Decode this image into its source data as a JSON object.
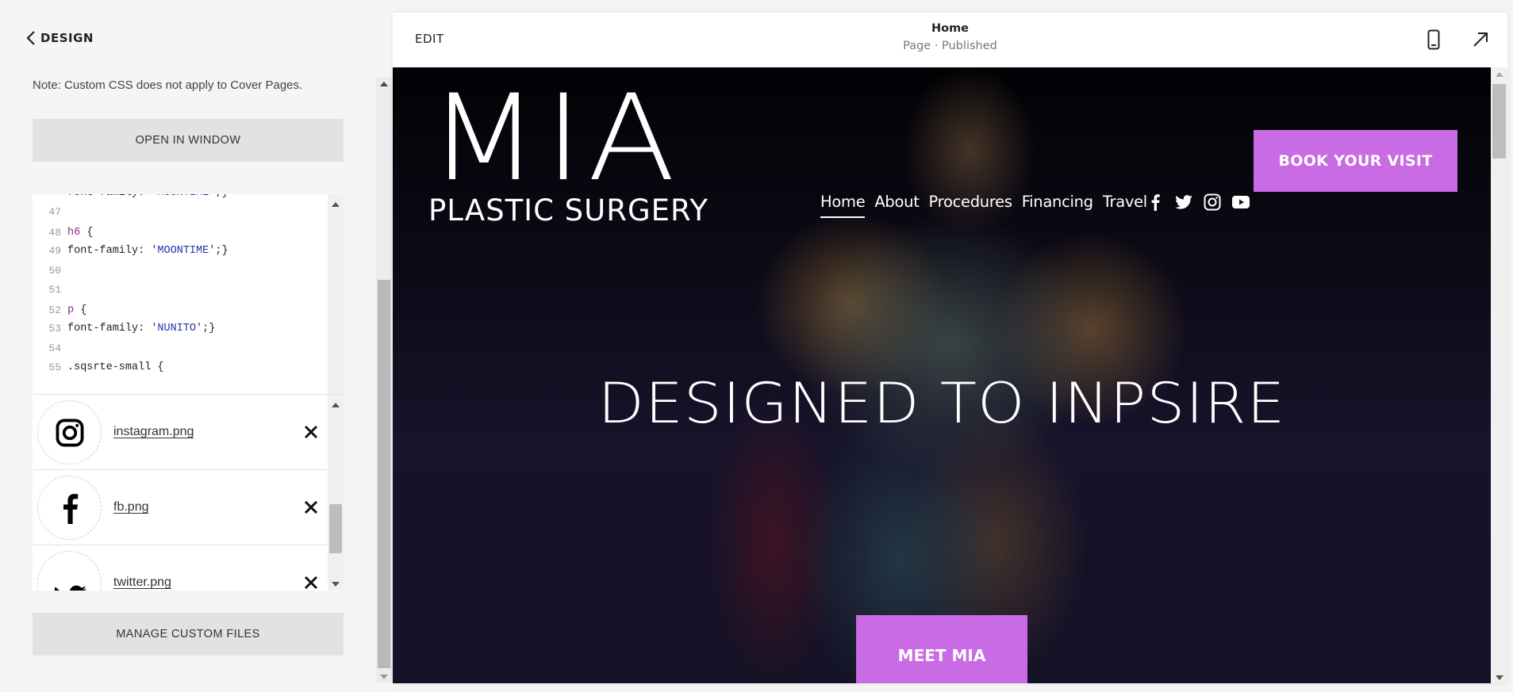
{
  "sidebar": {
    "back_label": "DESIGN",
    "note": "Note: Custom CSS does not apply to Cover Pages.",
    "open_window_label": "OPEN IN WINDOW",
    "manage_files_label": "MANAGE CUSTOM FILES",
    "code_lines": [
      {
        "num": "",
        "text": "font-family: 'MOONTIME';}"
      },
      {
        "num": "47",
        "text": ""
      },
      {
        "num": "48",
        "text": "h6 {"
      },
      {
        "num": "49",
        "text": "font-family: 'MOONTIME';}"
      },
      {
        "num": "50",
        "text": ""
      },
      {
        "num": "51",
        "text": ""
      },
      {
        "num": "52",
        "text": "p {"
      },
      {
        "num": "53",
        "text": "font-family: 'NUNITO';}"
      },
      {
        "num": "54",
        "text": ""
      },
      {
        "num": "55",
        "text": ".sqsrte-small {"
      }
    ],
    "files": [
      {
        "name": "instagram.png",
        "icon": "instagram-icon"
      },
      {
        "name": "fb.png",
        "icon": "facebook-icon"
      },
      {
        "name": "twitter.png",
        "icon": "twitter-icon"
      }
    ]
  },
  "preview": {
    "edit_label": "EDIT",
    "page_title": "Home",
    "page_status": "Page · Published",
    "site": {
      "logo_main": "MIA",
      "logo_sub": "PLASTIC SURGERY",
      "nav": [
        "Home",
        "About",
        "Procedures",
        "Financing",
        "Travel"
      ],
      "active_nav": "Home",
      "social": [
        "facebook",
        "twitter",
        "instagram",
        "youtube"
      ],
      "book_label": "BOOK YOUR VISIT",
      "hero_title": "DESIGNED TO INPSIRE",
      "meet_label": "MEET MIA",
      "accent_color": "#c96be4"
    }
  }
}
